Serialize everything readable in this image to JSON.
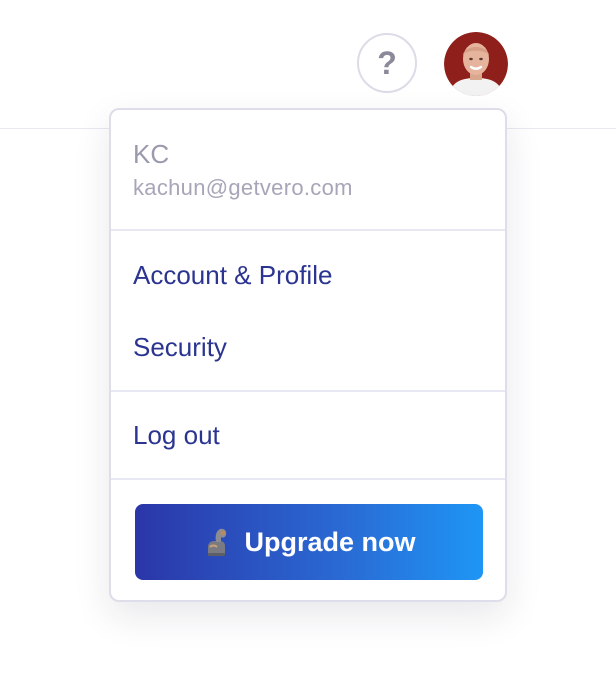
{
  "header": {
    "help_label": "?"
  },
  "user": {
    "name": "KC",
    "email": "kachun@getvero.com"
  },
  "menu": {
    "account_label": "Account & Profile",
    "security_label": "Security",
    "logout_label": "Log out"
  },
  "upgrade": {
    "label": "Upgrade now",
    "icon": "flexed-biceps-icon"
  },
  "colors": {
    "menu_text": "#2b3591",
    "muted_text": "#9a9aae",
    "gradient_start": "#2b36a8",
    "gradient_end": "#1e96f5"
  }
}
